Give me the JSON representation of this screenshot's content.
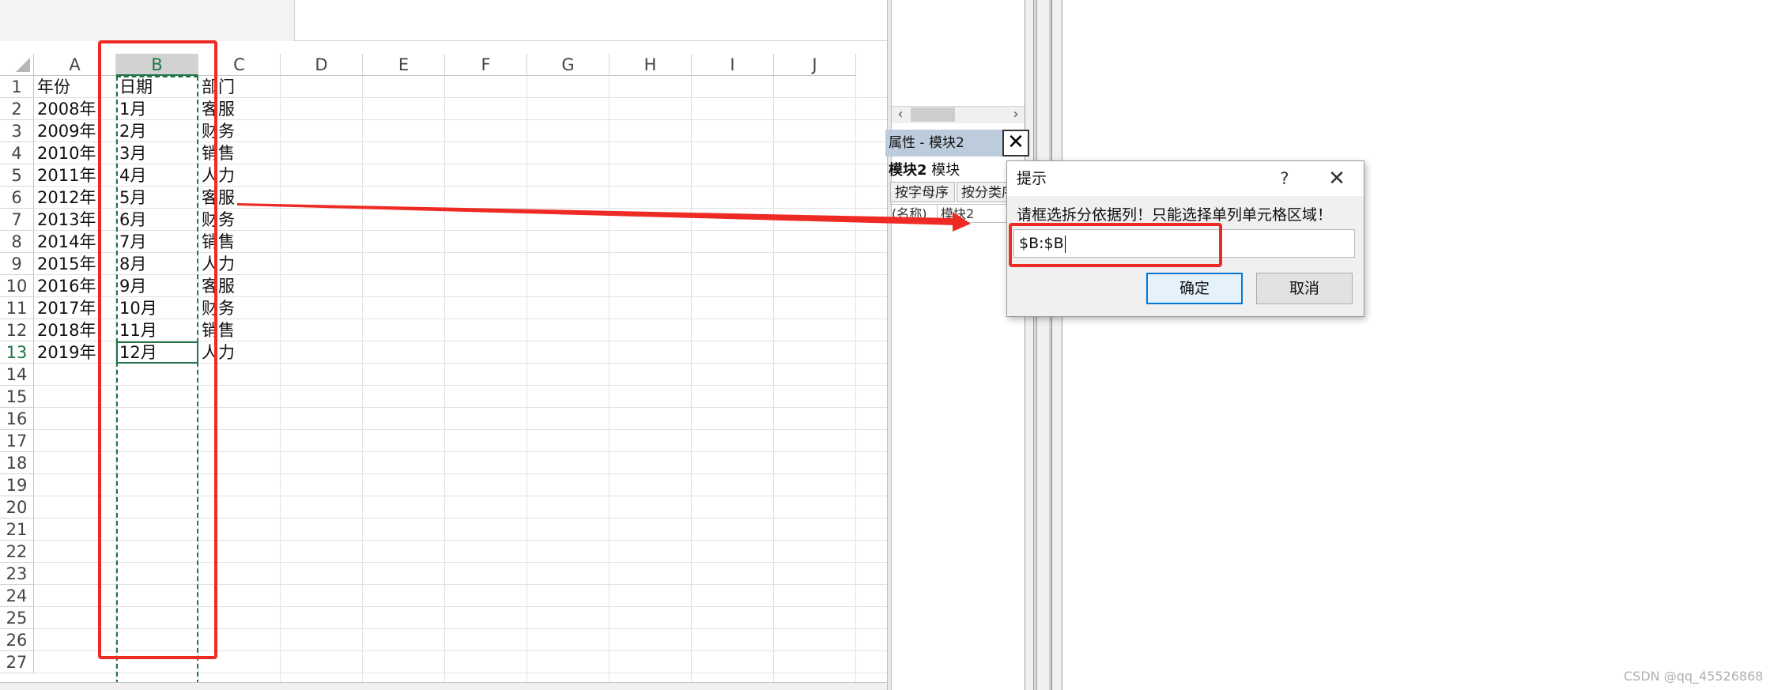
{
  "spreadsheet": {
    "columns": [
      "A",
      "B",
      "C",
      "D",
      "E",
      "F",
      "G",
      "H",
      "I",
      "J"
    ],
    "selected_column": "B",
    "row_numbers": [
      "1",
      "2",
      "3",
      "4",
      "5",
      "6",
      "7",
      "8",
      "9",
      "10",
      "11",
      "12",
      "13",
      "14",
      "15",
      "16",
      "17",
      "18",
      "19",
      "20",
      "21",
      "22",
      "23",
      "24",
      "25",
      "26",
      "27"
    ],
    "rows": [
      [
        "年份",
        "日期",
        "部门"
      ],
      [
        "2008年",
        "1月",
        "客服"
      ],
      [
        "2009年",
        "2月",
        "财务"
      ],
      [
        "2010年",
        "3月",
        "销售"
      ],
      [
        "2011年",
        "4月",
        "人力"
      ],
      [
        "2012年",
        "5月",
        "客服"
      ],
      [
        "2013年",
        "6月",
        "财务"
      ],
      [
        "2014年",
        "7月",
        "销售"
      ],
      [
        "2015年",
        "8月",
        "人力"
      ],
      [
        "2016年",
        "9月",
        "客服"
      ],
      [
        "2017年",
        "10月",
        "财务"
      ],
      [
        "2018年",
        "11月",
        "销售"
      ],
      [
        "2019年",
        "12月",
        "人力"
      ]
    ]
  },
  "vbe": {
    "properties_title": "属性 - 模块2",
    "close_glyph": "✕",
    "object_name": "模块2",
    "object_type": "模块",
    "tab_alphabetic": "按字母序",
    "tab_categorized": "按分类序",
    "property_key": "(名称)",
    "property_value": "模块2",
    "scroll_left": "‹",
    "scroll_right": "›"
  },
  "dialog": {
    "title": "提示",
    "help_glyph": "?",
    "close_glyph": "✕",
    "prompt": "请框选拆分依据列！只能选择单列单元格区域！",
    "input_value": "$B:$B",
    "ok_label": "确定",
    "cancel_label": "取消"
  },
  "annotation_color": "#ee2a24",
  "selection_color": "#217346",
  "watermark": "CSDN @qq_45526868"
}
